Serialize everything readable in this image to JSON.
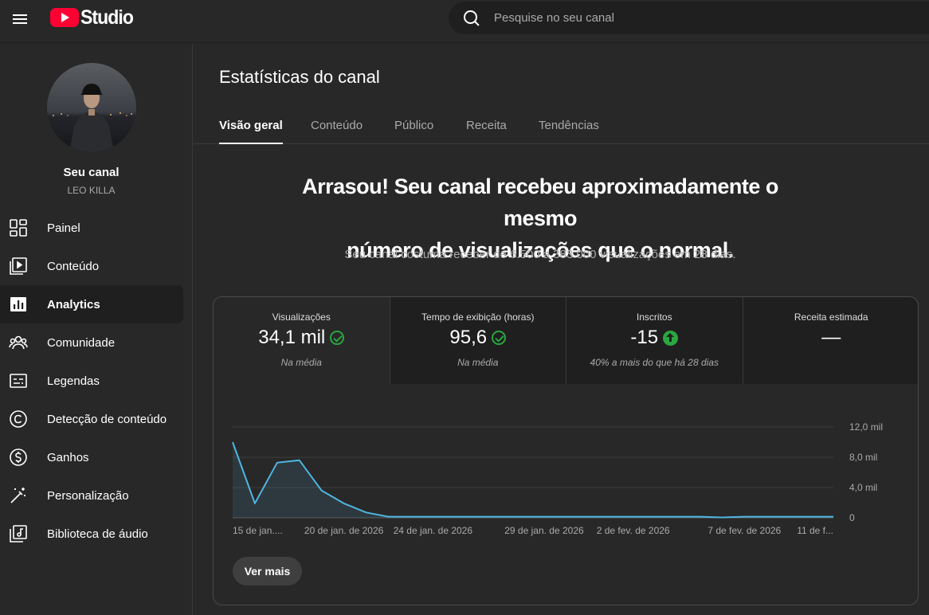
{
  "app": {
    "logo_text": "Studio"
  },
  "search": {
    "placeholder": "Pesquise no seu canal"
  },
  "sidebar": {
    "channel_title": "Seu canal",
    "channel_name": "LEO KILLA",
    "items": [
      {
        "label": "Painel",
        "icon": "dashboard-icon"
      },
      {
        "label": "Conteúdo",
        "icon": "content-icon"
      },
      {
        "label": "Analytics",
        "icon": "analytics-icon",
        "active": true
      },
      {
        "label": "Comunidade",
        "icon": "community-icon"
      },
      {
        "label": "Legendas",
        "icon": "subtitles-icon"
      },
      {
        "label": "Detecção de conteúdo",
        "icon": "copyright-icon"
      },
      {
        "label": "Ganhos",
        "icon": "earn-icon"
      },
      {
        "label": "Personalização",
        "icon": "customization-icon"
      },
      {
        "label": "Biblioteca de áudio",
        "icon": "audio-library-icon"
      }
    ]
  },
  "main": {
    "title": "Estatísticas do canal",
    "tabs": [
      "Visão geral",
      "Conteúdo",
      "Público",
      "Receita",
      "Tendências"
    ],
    "headline_line1": "Arrasou! Seu canal recebeu aproximadamente o mesmo",
    "headline_line2": "número de visualizações que o normal.",
    "subline": "Seu canal costuma receber de 6.500 a 383.000 visualizações em 28 dias."
  },
  "metrics": [
    {
      "label": "Visualizações",
      "value": "34,1 mil",
      "note": "Na média",
      "status": "check"
    },
    {
      "label": "Tempo de exibição (horas)",
      "value": "95,6",
      "note": "Na média",
      "status": "check"
    },
    {
      "label": "Inscritos",
      "value": "-15",
      "note": "40% a mais do que há 28 dias",
      "status": "up"
    },
    {
      "label": "Receita estimada",
      "value": "—",
      "note": "",
      "status": "none"
    }
  ],
  "colors": {
    "line": "#4fb5e0",
    "positive": "#2ba640",
    "brand": "#ff0033"
  },
  "chart_data": {
    "type": "area",
    "y_ticks": [
      "0",
      "4,0 mil",
      "8,0 mil",
      "12,0 mil"
    ],
    "ylim": [
      0,
      12000
    ],
    "x_labels": [
      "15 de jan....",
      "20 de jan. de 2026",
      "24 de jan. de 2026",
      "29 de jan. de 2026",
      "2 de fev. de 2026",
      "7 de fev. de 2026",
      "11 de f..."
    ],
    "series": [
      {
        "values": [
          10000,
          1900,
          7300,
          7600,
          3600,
          1900,
          700,
          150,
          150,
          150,
          150,
          150,
          150,
          150,
          150,
          150,
          150,
          150,
          150,
          150,
          150,
          150,
          50,
          150,
          150,
          150,
          150,
          150
        ]
      }
    ]
  },
  "actions": {
    "see_more": "Ver mais"
  }
}
